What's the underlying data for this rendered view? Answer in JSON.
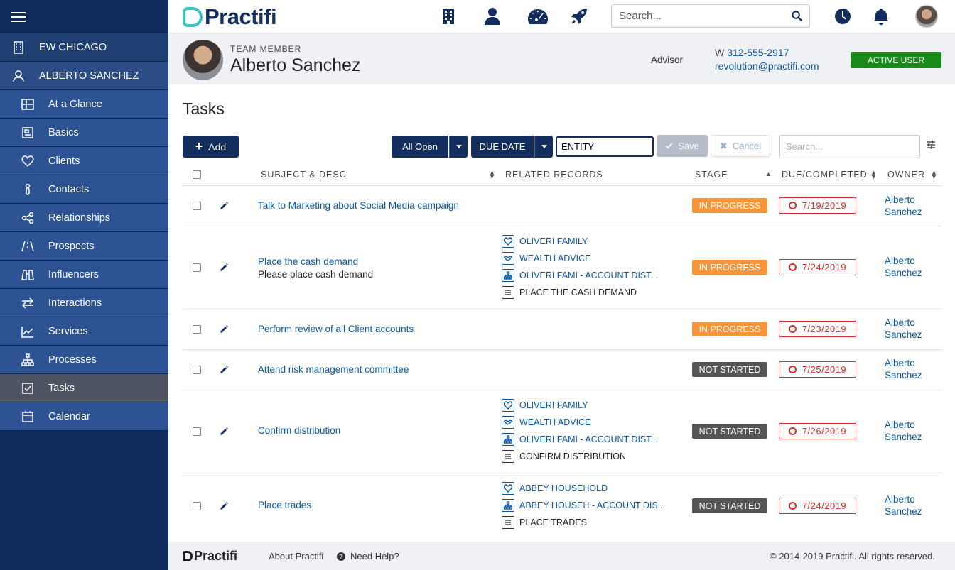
{
  "app": {
    "logo_text": "Practifi"
  },
  "sidebar": {
    "firm": "EW CHICAGO",
    "member": "ALBERTO SANCHEZ",
    "items": [
      {
        "label": "At a Glance",
        "icon": "grid-icon"
      },
      {
        "label": "Basics",
        "icon": "document-icon"
      },
      {
        "label": "Clients",
        "icon": "heart-icon"
      },
      {
        "label": "Contacts",
        "icon": "person-icon"
      },
      {
        "label": "Relationships",
        "icon": "share-icon"
      },
      {
        "label": "Prospects",
        "icon": "road-icon"
      },
      {
        "label": "Influencers",
        "icon": "binoculars-icon"
      },
      {
        "label": "Interactions",
        "icon": "arrows-icon"
      },
      {
        "label": "Services",
        "icon": "chart-icon"
      },
      {
        "label": "Processes",
        "icon": "hierarchy-icon"
      },
      {
        "label": "Tasks",
        "icon": "checkbox-icon"
      },
      {
        "label": "Calendar",
        "icon": "calendar-icon"
      }
    ],
    "active": "Tasks"
  },
  "topbar": {
    "search_placeholder": "Search..."
  },
  "header": {
    "label": "TEAM MEMBER",
    "name": "Alberto Sanchez",
    "role": "Advisor",
    "phone_prefix": "W",
    "phone": "312-555-2917",
    "email": "revolution@practifi.com",
    "status": "ACTIVE USER",
    "status_color": "#1a8a1a"
  },
  "main": {
    "title": "Tasks",
    "add_label": "Add",
    "view_label": "All Open",
    "sort_label": "DUE DATE",
    "group_value": "ENTITY",
    "save_label": "Save",
    "cancel_label": "Cancel",
    "search_placeholder": "Search..."
  },
  "table": {
    "columns": {
      "subject": "SUBJECT & DESC",
      "related": "RELATED RECORDS",
      "stage": "STAGE",
      "due": "DUE/COMPLETED",
      "owner": "OWNER"
    },
    "rows": [
      {
        "subject": "Talk to Marketing about Social Media campaign",
        "desc": "",
        "related": [],
        "stage": "IN PROGRESS",
        "due": "7/19/2019",
        "owner1": "Alberto",
        "owner2": "Sanchez"
      },
      {
        "subject": "Place the cash demand",
        "desc": "Please place cash demand",
        "related": [
          {
            "label": "OLIVERI FAMILY",
            "icon": "heart-icon"
          },
          {
            "label": "WEALTH ADVICE",
            "icon": "handshake-icon"
          },
          {
            "label": "OLIVERI FAMI - ACCOUNT DIST...",
            "icon": "hierarchy-icon"
          },
          {
            "label": "PLACE THE CASH DEMAND",
            "icon": "list-icon"
          }
        ],
        "stage": "IN PROGRESS",
        "due": "7/24/2019",
        "owner1": "Alberto",
        "owner2": "Sanchez"
      },
      {
        "subject": "Perform review of all Client accounts",
        "desc": "",
        "related": [],
        "stage": "IN PROGRESS",
        "due": "7/23/2019",
        "owner1": "Alberto",
        "owner2": "Sanchez"
      },
      {
        "subject": "Attend risk management committee",
        "desc": "",
        "related": [],
        "stage": "NOT STARTED",
        "due": "7/25/2019",
        "owner1": "Alberto",
        "owner2": "Sanchez"
      },
      {
        "subject": "Confirm distribution",
        "desc": "",
        "related": [
          {
            "label": "OLIVERI FAMILY",
            "icon": "heart-icon"
          },
          {
            "label": "WEALTH ADVICE",
            "icon": "handshake-icon"
          },
          {
            "label": "OLIVERI FAMI - ACCOUNT DIST...",
            "icon": "hierarchy-icon"
          },
          {
            "label": "CONFIRM DISTRIBUTION",
            "icon": "list-icon"
          }
        ],
        "stage": "NOT STARTED",
        "due": "7/26/2019",
        "owner1": "Alberto",
        "owner2": "Sanchez"
      },
      {
        "subject": "Place trades",
        "desc": "",
        "related": [
          {
            "label": "ABBEY HOUSEHOLD",
            "icon": "heart-icon"
          },
          {
            "label": "ABBEY HOUSEH - ACCOUNT DIS...",
            "icon": "hierarchy-icon"
          },
          {
            "label": "PLACE TRADES",
            "icon": "list-icon"
          }
        ],
        "stage": "NOT STARTED",
        "due": "7/24/2019",
        "owner1": "Alberto",
        "owner2": "Sanchez"
      }
    ]
  },
  "footer": {
    "logo_text": "Practifi",
    "about": "About Practifi",
    "help": "Need Help?",
    "copyright": "© 2014-2019 Practifi. All rights reserved."
  }
}
